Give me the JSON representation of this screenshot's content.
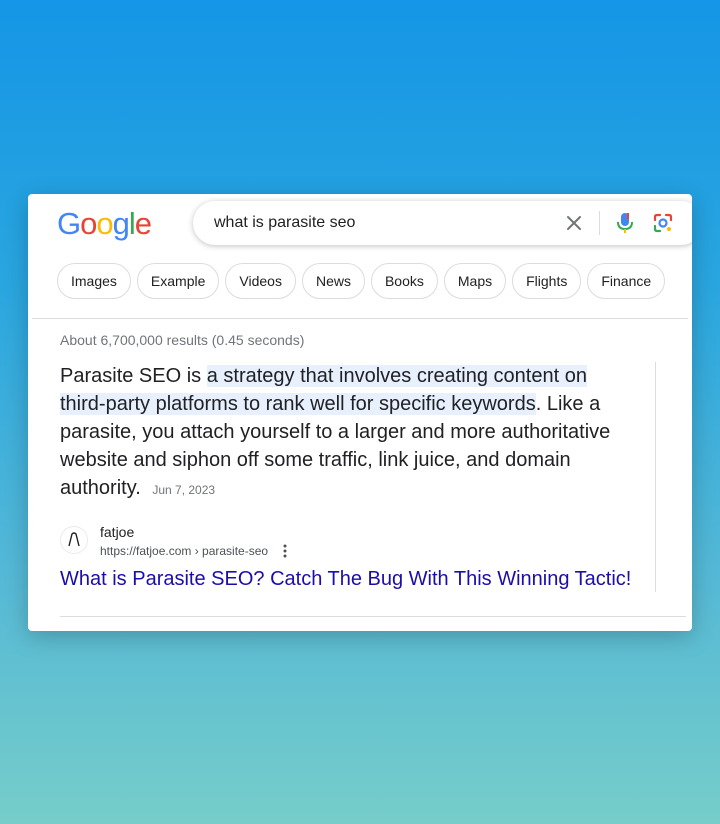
{
  "logo": {
    "letters": [
      {
        "char": "G",
        "color": "#4285F4"
      },
      {
        "char": "o",
        "color": "#EA4335"
      },
      {
        "char": "o",
        "color": "#FBBC05"
      },
      {
        "char": "g",
        "color": "#4285F4"
      },
      {
        "char": "l",
        "color": "#34A853"
      },
      {
        "char": "e",
        "color": "#EA4335"
      }
    ]
  },
  "search": {
    "query": "what is parasite seo"
  },
  "icons": {
    "clear": "close-icon",
    "voice": "microphone-icon",
    "lens": "google-lens-icon",
    "more": "more-vert-icon"
  },
  "chips": [
    "Images",
    "Example",
    "Videos",
    "News",
    "Books",
    "Maps",
    "Flights",
    "Finance"
  ],
  "stats": "About 6,700,000 results (0.45 seconds)",
  "snippet": {
    "before": "Parasite SEO is ",
    "highlight": "a strategy that involves creating content on third-party platforms to rank well for specific keywords",
    "after": ". Like a parasite, you attach yourself to a larger and more authoritative website and siphon off some traffic, link juice, and domain authority.",
    "date": "Jun 7, 2023"
  },
  "result": {
    "site_name": "fatjoe",
    "url": "https://fatjoe.com › parasite-seo",
    "title": "What is Parasite SEO? Catch The Bug With This Winning Tactic!"
  },
  "colors": {
    "link": "#1a0dab",
    "highlight": "#e8f0fe",
    "mic_blue": "#4285F4",
    "mic_red": "#EA4335"
  }
}
